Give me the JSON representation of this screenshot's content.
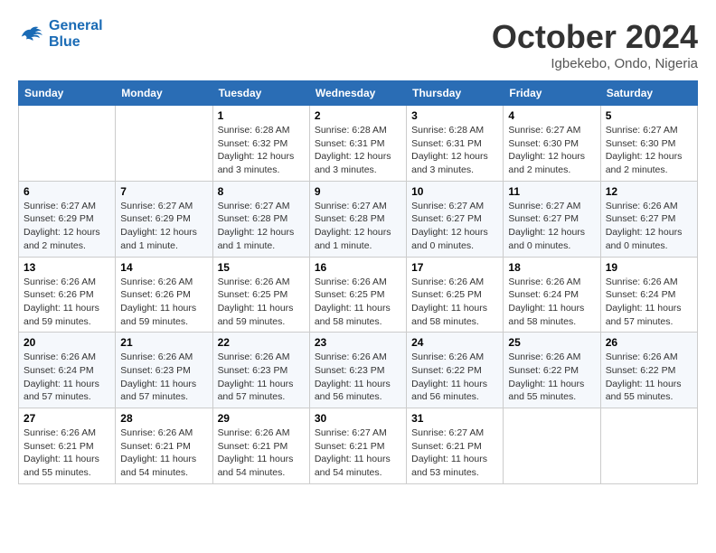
{
  "logo": {
    "line1": "General",
    "line2": "Blue"
  },
  "title": "October 2024",
  "subtitle": "Igbekebo, Ondo, Nigeria",
  "weekdays": [
    "Sunday",
    "Monday",
    "Tuesday",
    "Wednesday",
    "Thursday",
    "Friday",
    "Saturday"
  ],
  "weeks": [
    [
      {
        "day": "",
        "info": ""
      },
      {
        "day": "",
        "info": ""
      },
      {
        "day": "1",
        "info": "Sunrise: 6:28 AM\nSunset: 6:32 PM\nDaylight: 12 hours and 3 minutes."
      },
      {
        "day": "2",
        "info": "Sunrise: 6:28 AM\nSunset: 6:31 PM\nDaylight: 12 hours and 3 minutes."
      },
      {
        "day": "3",
        "info": "Sunrise: 6:28 AM\nSunset: 6:31 PM\nDaylight: 12 hours and 3 minutes."
      },
      {
        "day": "4",
        "info": "Sunrise: 6:27 AM\nSunset: 6:30 PM\nDaylight: 12 hours and 2 minutes."
      },
      {
        "day": "5",
        "info": "Sunrise: 6:27 AM\nSunset: 6:30 PM\nDaylight: 12 hours and 2 minutes."
      }
    ],
    [
      {
        "day": "6",
        "info": "Sunrise: 6:27 AM\nSunset: 6:29 PM\nDaylight: 12 hours and 2 minutes."
      },
      {
        "day": "7",
        "info": "Sunrise: 6:27 AM\nSunset: 6:29 PM\nDaylight: 12 hours and 1 minute."
      },
      {
        "day": "8",
        "info": "Sunrise: 6:27 AM\nSunset: 6:28 PM\nDaylight: 12 hours and 1 minute."
      },
      {
        "day": "9",
        "info": "Sunrise: 6:27 AM\nSunset: 6:28 PM\nDaylight: 12 hours and 1 minute."
      },
      {
        "day": "10",
        "info": "Sunrise: 6:27 AM\nSunset: 6:27 PM\nDaylight: 12 hours and 0 minutes."
      },
      {
        "day": "11",
        "info": "Sunrise: 6:27 AM\nSunset: 6:27 PM\nDaylight: 12 hours and 0 minutes."
      },
      {
        "day": "12",
        "info": "Sunrise: 6:26 AM\nSunset: 6:27 PM\nDaylight: 12 hours and 0 minutes."
      }
    ],
    [
      {
        "day": "13",
        "info": "Sunrise: 6:26 AM\nSunset: 6:26 PM\nDaylight: 11 hours and 59 minutes."
      },
      {
        "day": "14",
        "info": "Sunrise: 6:26 AM\nSunset: 6:26 PM\nDaylight: 11 hours and 59 minutes."
      },
      {
        "day": "15",
        "info": "Sunrise: 6:26 AM\nSunset: 6:25 PM\nDaylight: 11 hours and 59 minutes."
      },
      {
        "day": "16",
        "info": "Sunrise: 6:26 AM\nSunset: 6:25 PM\nDaylight: 11 hours and 58 minutes."
      },
      {
        "day": "17",
        "info": "Sunrise: 6:26 AM\nSunset: 6:25 PM\nDaylight: 11 hours and 58 minutes."
      },
      {
        "day": "18",
        "info": "Sunrise: 6:26 AM\nSunset: 6:24 PM\nDaylight: 11 hours and 58 minutes."
      },
      {
        "day": "19",
        "info": "Sunrise: 6:26 AM\nSunset: 6:24 PM\nDaylight: 11 hours and 57 minutes."
      }
    ],
    [
      {
        "day": "20",
        "info": "Sunrise: 6:26 AM\nSunset: 6:24 PM\nDaylight: 11 hours and 57 minutes."
      },
      {
        "day": "21",
        "info": "Sunrise: 6:26 AM\nSunset: 6:23 PM\nDaylight: 11 hours and 57 minutes."
      },
      {
        "day": "22",
        "info": "Sunrise: 6:26 AM\nSunset: 6:23 PM\nDaylight: 11 hours and 57 minutes."
      },
      {
        "day": "23",
        "info": "Sunrise: 6:26 AM\nSunset: 6:23 PM\nDaylight: 11 hours and 56 minutes."
      },
      {
        "day": "24",
        "info": "Sunrise: 6:26 AM\nSunset: 6:22 PM\nDaylight: 11 hours and 56 minutes."
      },
      {
        "day": "25",
        "info": "Sunrise: 6:26 AM\nSunset: 6:22 PM\nDaylight: 11 hours and 55 minutes."
      },
      {
        "day": "26",
        "info": "Sunrise: 6:26 AM\nSunset: 6:22 PM\nDaylight: 11 hours and 55 minutes."
      }
    ],
    [
      {
        "day": "27",
        "info": "Sunrise: 6:26 AM\nSunset: 6:21 PM\nDaylight: 11 hours and 55 minutes."
      },
      {
        "day": "28",
        "info": "Sunrise: 6:26 AM\nSunset: 6:21 PM\nDaylight: 11 hours and 54 minutes."
      },
      {
        "day": "29",
        "info": "Sunrise: 6:26 AM\nSunset: 6:21 PM\nDaylight: 11 hours and 54 minutes."
      },
      {
        "day": "30",
        "info": "Sunrise: 6:27 AM\nSunset: 6:21 PM\nDaylight: 11 hours and 54 minutes."
      },
      {
        "day": "31",
        "info": "Sunrise: 6:27 AM\nSunset: 6:21 PM\nDaylight: 11 hours and 53 minutes."
      },
      {
        "day": "",
        "info": ""
      },
      {
        "day": "",
        "info": ""
      }
    ]
  ]
}
